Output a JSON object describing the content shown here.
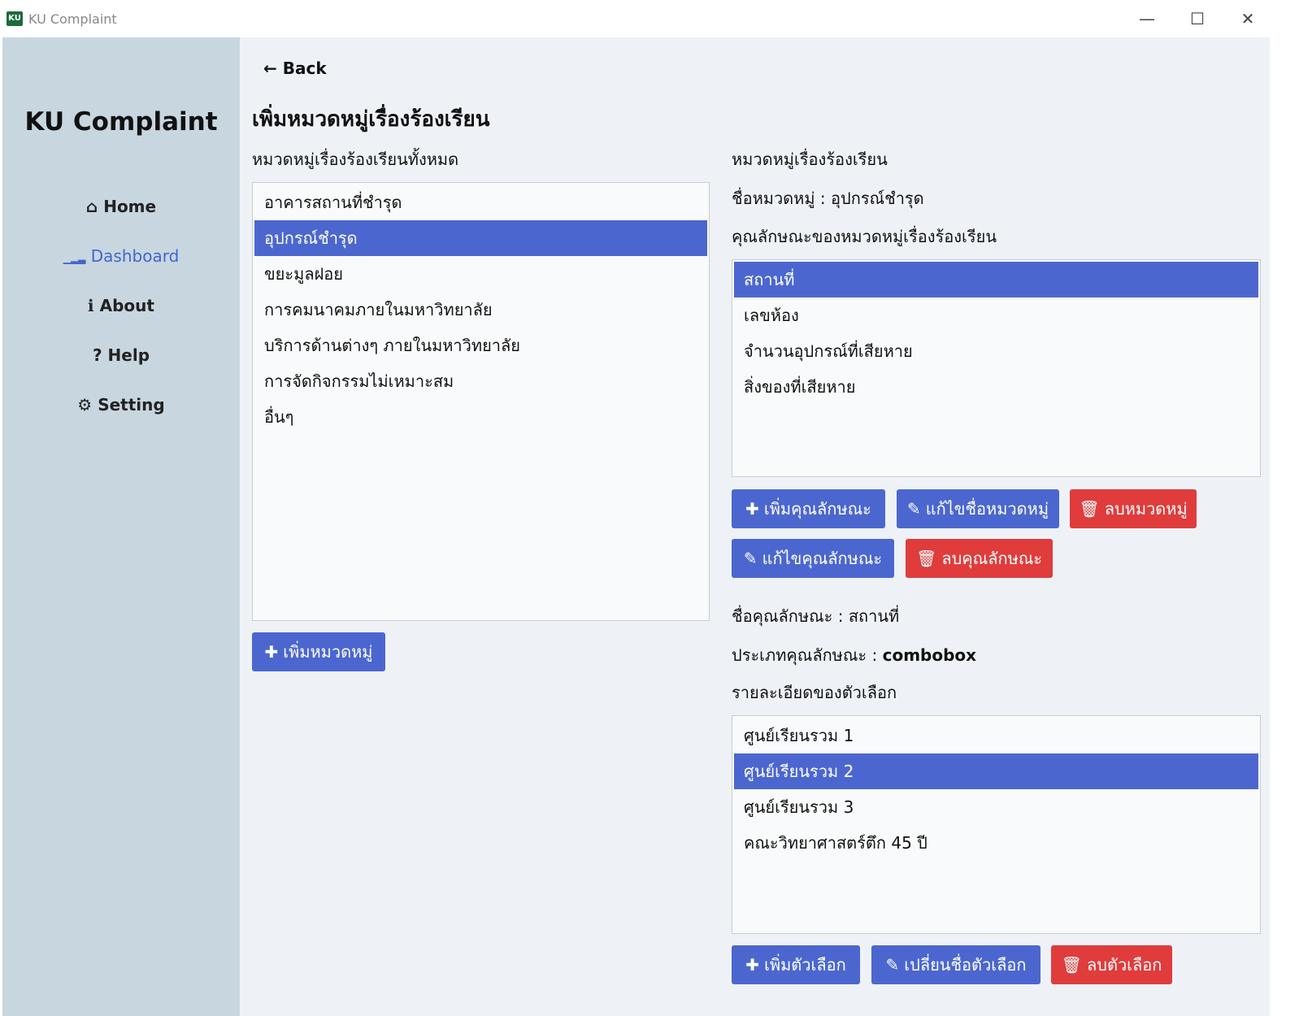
{
  "window": {
    "title": "KU Complaint",
    "icon_text": "KU",
    "minimize": "—",
    "maximize": "☐",
    "close": "✕"
  },
  "sidebar": {
    "brand": "KU Complaint",
    "items": [
      {
        "icon": "⌂",
        "label": "Home"
      },
      {
        "icon": "▁▂▃",
        "label": "Dashboard"
      },
      {
        "icon": "ℹ",
        "label": "About"
      },
      {
        "icon": "?",
        "label": "Help"
      },
      {
        "icon": "⚙",
        "label": "Setting"
      }
    ]
  },
  "main": {
    "back_label": "Back",
    "back_icon": "←",
    "page_title": "เพิ่มหมวดหมู่เรื่องร้องเรียน",
    "all_categories_label": "หมวดหมู่เรื่องร้องเรียนทั้งหมด",
    "categories": [
      "อาคารสถานที่ชำรุด",
      "อุปกรณ์ชำรุด",
      "ขยะมูลฝอย",
      "การคมนาคมภายในมหาวิทยาลัย",
      "บริการด้านต่างๆ ภายในมหาวิทยาลัย",
      "การจัดกิจกรรมไม่เหมาะสม",
      "อื่นๆ"
    ],
    "selected_category_index": 1,
    "add_category_button": "เพิ่มหมวดหมู่",
    "detail": {
      "section_label": "หมวดหมู่เรื่องร้องเรียน",
      "category_name_prefix": "ชื่อหมวดหมู่ : ",
      "category_name": "อุปกรณ์ชำรุด",
      "attributes_label": "คุณลักษณะของหมวดหมู่เรื่องร้องเรียน",
      "attributes": [
        "สถานที่",
        "เลขห้อง",
        "จำนวนอุปกรณ์ที่เสียหาย",
        "สิ่งของที่เสียหาย"
      ],
      "selected_attribute_index": 0,
      "add_attribute_button": "เพิ่มคุณลักษณะ",
      "edit_category_button": "แก้ไขชื่อหมวดหมู่",
      "delete_category_button": "ลบหมวดหมู่",
      "edit_attribute_button": "แก้ไขคุณลักษณะ",
      "delete_attribute_button": "ลบคุณลักษณะ",
      "attribute_name_prefix": "ชื่อคุณลักษณะ : ",
      "attribute_name": "สถานที่",
      "attribute_type_prefix": "ประเภทคุณลักษณะ : ",
      "attribute_type": "combobox",
      "options_label": "รายละเอียดของตัวเลือก",
      "options": [
        "ศูนย์เรียนรวม 1",
        "ศูนย์เรียนรวม 2",
        "ศูนย์เรียนรวม 3",
        "คณะวิทยาศาสตร์ตึก 45 ปี"
      ],
      "selected_option_index": 1,
      "add_option_button": "เพิ่มตัวเลือก",
      "rename_option_button": "เปลี่ยนชื่อตัวเลือก",
      "delete_option_button": "ลบตัวเลือก"
    }
  },
  "icons": {
    "plus": "✚",
    "pencil": "✎",
    "trash": "🗑"
  },
  "colors": {
    "sidebar_bg": "#c8d6e0",
    "main_bg": "#eef2f7",
    "primary": "#4b67cf",
    "danger": "#e03c3c",
    "active_nav": "#4466cc"
  }
}
